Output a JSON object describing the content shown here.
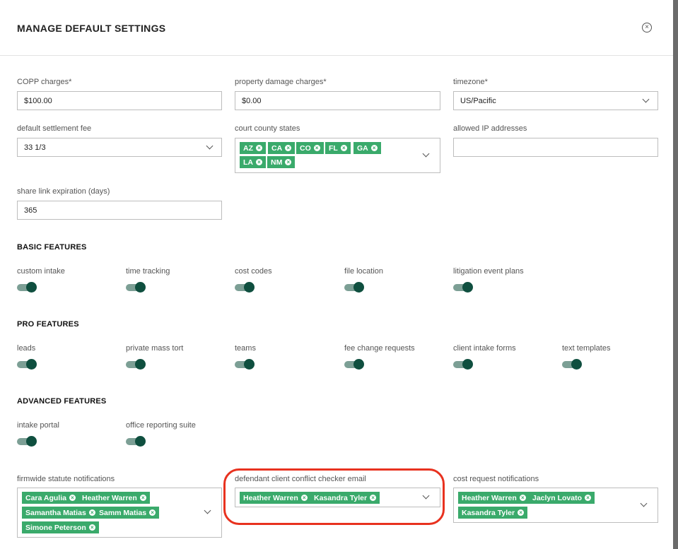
{
  "modal": {
    "title": "MANAGE DEFAULT SETTINGS",
    "close_icon": "×"
  },
  "fields": {
    "copp": {
      "label": "COPP charges*",
      "value": "$100.00"
    },
    "property": {
      "label": "property damage charges*",
      "value": "$0.00"
    },
    "timezone": {
      "label": "timezone*",
      "value": "US/Pacific"
    },
    "settlement": {
      "label": "default settlement fee",
      "value": "33 1/3"
    },
    "states": {
      "label": "court county states",
      "tags": [
        "AZ",
        "CA",
        "CO",
        "FL",
        "GA",
        "LA",
        "NM"
      ]
    },
    "ip": {
      "label": "allowed IP addresses",
      "value": ""
    },
    "share": {
      "label": "share link expiration (days)",
      "value": "365"
    }
  },
  "basic": {
    "title": "BASIC FEATURES",
    "items": [
      "custom intake",
      "time tracking",
      "cost codes",
      "file location",
      "litigation event plans"
    ]
  },
  "pro": {
    "title": "PRO FEATURES",
    "items": [
      "leads",
      "private mass tort",
      "teams",
      "fee change requests",
      "client intake forms",
      "text templates"
    ]
  },
  "advanced": {
    "title": "ADVANCED FEATURES",
    "items": [
      "intake portal",
      "office reporting suite"
    ]
  },
  "notifications": {
    "statute": {
      "label": "firmwide statute notifications",
      "tags": [
        "Cara Agulia",
        "Heather Warren",
        "Samantha Matias",
        "Samm Matias",
        "Simone Peterson"
      ]
    },
    "conflict": {
      "label": "defendant client conflict checker email",
      "tags": [
        "Heather Warren",
        "Kasandra Tyler"
      ]
    },
    "cost": {
      "label": "cost request notifications",
      "tags": [
        "Heather Warren",
        "Jaclyn Lovato",
        "Kasandra Tyler"
      ]
    }
  },
  "colors": {
    "tag": "#3aaa6b",
    "toggle_knob": "#0f4f3f",
    "highlight": "#e8321f"
  },
  "tag_remove_icon": "×"
}
